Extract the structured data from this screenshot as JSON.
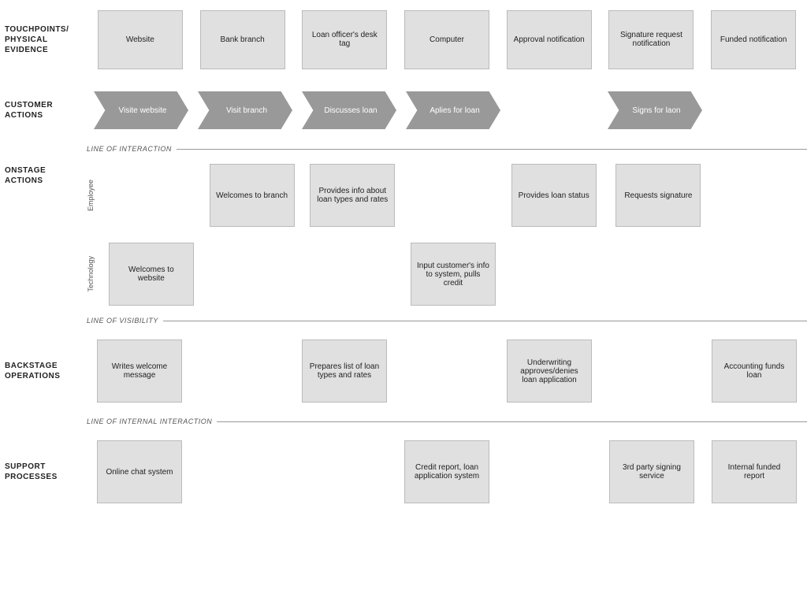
{
  "sections": {
    "touchpoints": {
      "label": "TOUCHPOINTS/ PHYSICAL EVIDENCE",
      "items": [
        {
          "id": "website",
          "text": "Website",
          "col": 1
        },
        {
          "id": "bank-branch",
          "text": "Bank branch",
          "col": 2
        },
        {
          "id": "loan-officer-desk",
          "text": "Loan officer's desk tag",
          "col": 3
        },
        {
          "id": "computer",
          "text": "Computer",
          "col": 4
        },
        {
          "id": "approval-notification",
          "text": "Approval notification",
          "col": 5
        },
        {
          "id": "signature-request",
          "text": "Signature request notification",
          "col": 6
        },
        {
          "id": "funded-notification",
          "text": "Funded notification",
          "col": 7
        }
      ]
    },
    "customer_actions": {
      "label": "CUSTOMER ACTIONS",
      "items": [
        {
          "id": "visite-website",
          "text": "Visite website",
          "col": 1
        },
        {
          "id": "visit-branch",
          "text": "Visit branch",
          "col": 2
        },
        {
          "id": "discusses-loan",
          "text": "Discusses loan",
          "col": 3
        },
        {
          "id": "applies-for-loan",
          "text": "Aplies for loan",
          "col": 4
        },
        {
          "id": "signs-for-loan",
          "text": "Signs for laon",
          "col": 6
        }
      ]
    },
    "line_interaction": {
      "label": "LINE OF INTERACTION"
    },
    "onstage": {
      "label": "ONSTAGE ACTIONS",
      "employee_label": "Employee",
      "technology_label": "Technology",
      "employee_items": [
        {
          "id": "welcomes-to-branch",
          "text": "Welcomes to branch",
          "col": 2
        },
        {
          "id": "provides-info",
          "text": "Provides info about loan types and rates",
          "col": 3
        },
        {
          "id": "provides-loan-status",
          "text": "Provides loan status",
          "col": 5
        },
        {
          "id": "requests-signature",
          "text": "Requests signature",
          "col": 6
        }
      ],
      "technology_items": [
        {
          "id": "welcomes-to-website",
          "text": "Welcomes to website",
          "col": 1
        },
        {
          "id": "input-customer-info",
          "text": "Input customer's info to system, pulls credit",
          "col": 4
        }
      ]
    },
    "line_visibility": {
      "label": "LINE OF VISIBILITY"
    },
    "backstage": {
      "label": "BACKSTAGE OPERATIONS",
      "items": [
        {
          "id": "writes-welcome",
          "text": "Writes welcome message",
          "col": 1
        },
        {
          "id": "prepares-list",
          "text": "Prepares list of loan types and rates",
          "col": 3
        },
        {
          "id": "underwriting",
          "text": "Underwriting approves/denies loan application",
          "col": 5
        },
        {
          "id": "accounting-funds",
          "text": "Accounting funds loan",
          "col": 7
        }
      ]
    },
    "line_internal": {
      "label": "LINE OF INTERNAL INTERACTION"
    },
    "support": {
      "label": "SUPPORT PROCESSES",
      "items": [
        {
          "id": "online-chat",
          "text": "Online chat system",
          "col": 1
        },
        {
          "id": "credit-report",
          "text": "Credit report, loan application system",
          "col": 4
        },
        {
          "id": "third-party",
          "text": "3rd party signing service",
          "col": 6
        },
        {
          "id": "internal-funded",
          "text": "Internal funded report",
          "col": 7
        }
      ]
    }
  },
  "colors": {
    "arrow": "#999999",
    "box": "#e0e0e0",
    "box_border": "#bbbbbb",
    "line": "#999999",
    "label_text": "#222222"
  }
}
